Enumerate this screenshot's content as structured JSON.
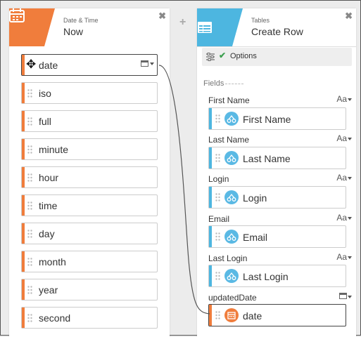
{
  "left_panel": {
    "subtitle": "Date & Time",
    "title": "Now",
    "close_glyph": "✖",
    "badge_icon": "calendar-icon",
    "badge_color": "#f07d3c",
    "outputs": [
      {
        "label": "date"
      },
      {
        "label": "iso"
      },
      {
        "label": "full"
      },
      {
        "label": "minute"
      },
      {
        "label": "hour"
      },
      {
        "label": "time"
      },
      {
        "label": "day"
      },
      {
        "label": "month"
      },
      {
        "label": "year"
      },
      {
        "label": "second"
      }
    ]
  },
  "connector": {
    "plus_glyph": "+"
  },
  "right_panel": {
    "subtitle": "Tables",
    "title": "Create Row",
    "close_glyph": "✖",
    "badge_icon": "table-icon",
    "badge_color": "#4db6e0",
    "options_label": "Options",
    "options_check": "✔",
    "fields_heading": "Fields",
    "type_text": "Aa",
    "fields": [
      {
        "label": "First Name",
        "token": "First Name"
      },
      {
        "label": "Last Name",
        "token": "Last Name"
      },
      {
        "label": "Login",
        "token": "Login"
      },
      {
        "label": "Email",
        "token": "Email"
      },
      {
        "label": "Last Login",
        "token": "Last Login"
      },
      {
        "label": "updatedDate",
        "token": "date"
      }
    ]
  }
}
